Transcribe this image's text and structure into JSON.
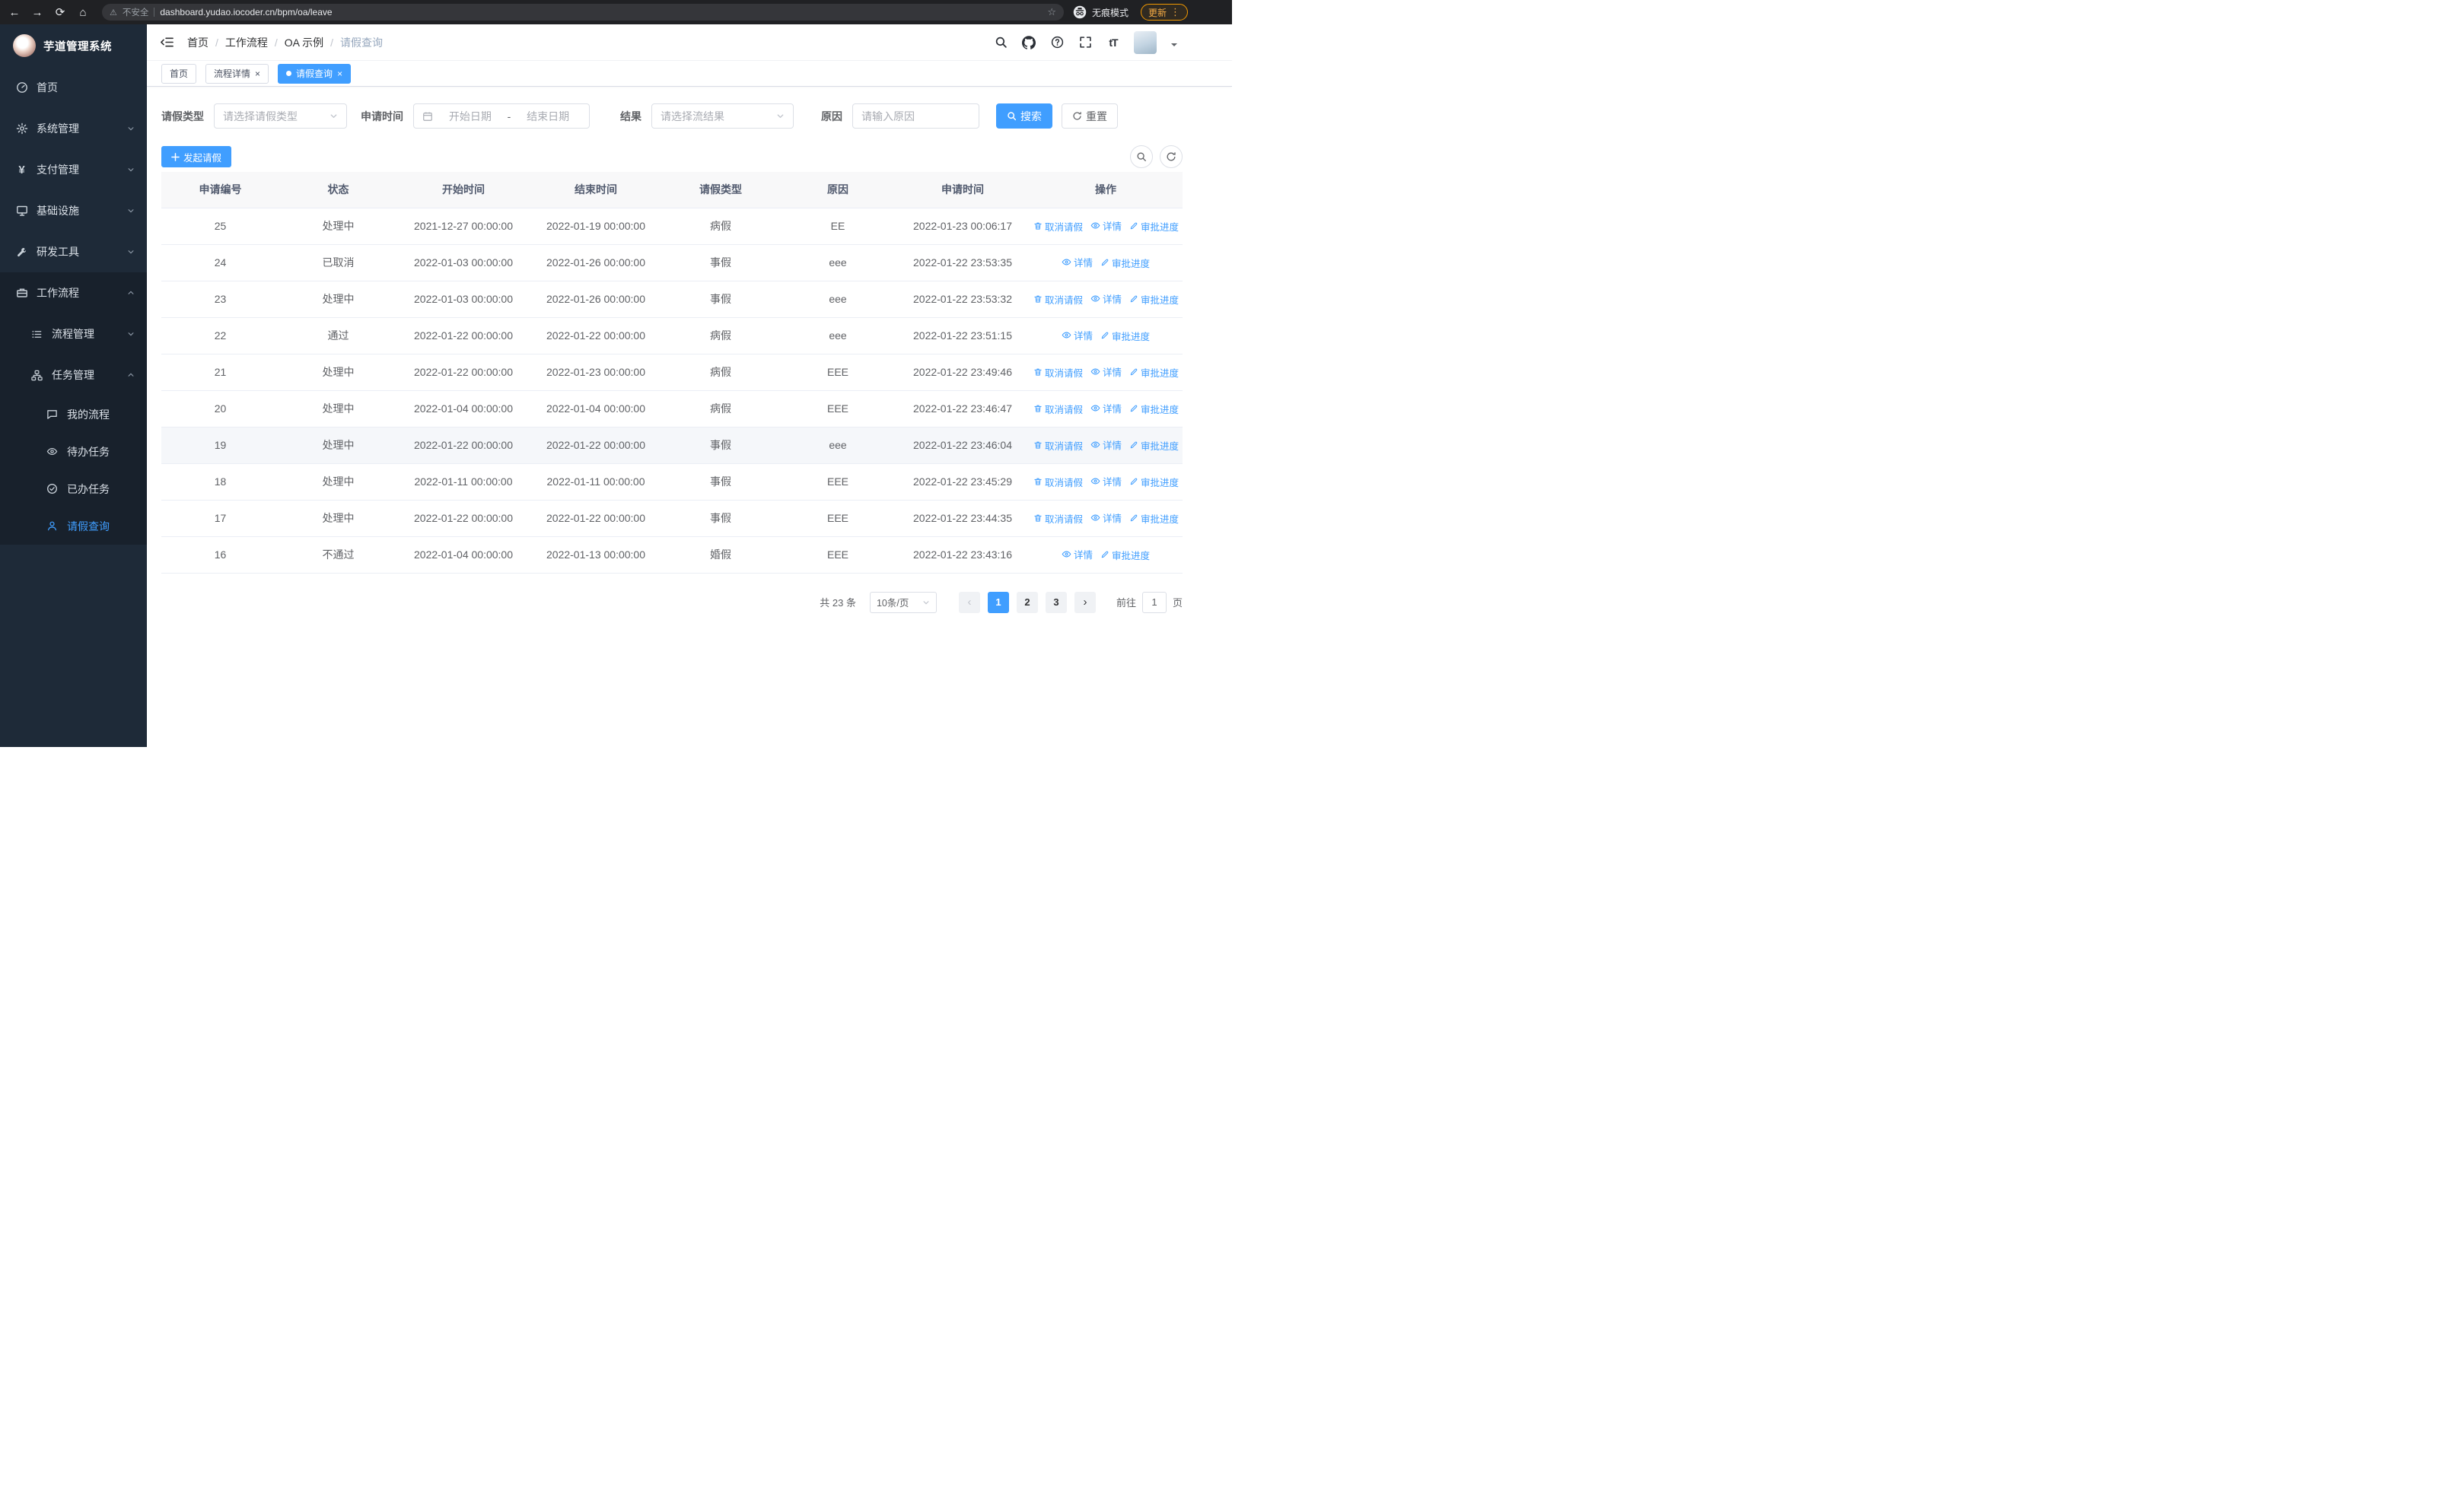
{
  "colors": {
    "accent": "#409eff",
    "sidebar_bg": "#1e2a38",
    "sidebar_submenu_bg": "#18212c"
  },
  "browser": {
    "security_label": "不安全",
    "url": "dashboard.yudao.iocoder.cn/bpm/oa/leave",
    "incognito_label": "无痕模式",
    "update_label": "更新"
  },
  "sidebar": {
    "app_title": "芋道管理系统",
    "items": [
      {
        "label": "首页",
        "icon": "dashboard-icon"
      },
      {
        "label": "系统管理",
        "icon": "gear-icon"
      },
      {
        "label": "支付管理",
        "icon": "yen-icon"
      },
      {
        "label": "基础设施",
        "icon": "monitor-icon"
      },
      {
        "label": "研发工具",
        "icon": "wrench-icon"
      },
      {
        "label": "工作流程",
        "icon": "briefcase-icon",
        "expanded": true
      },
      {
        "label": "流程管理",
        "icon": "list-icon"
      },
      {
        "label": "任务管理",
        "icon": "org-icon",
        "expanded": true
      },
      {
        "label": "我的流程",
        "icon": "chat-icon"
      },
      {
        "label": "待办任务",
        "icon": "eye-icon"
      },
      {
        "label": "已办任务",
        "icon": "check-circle-icon"
      },
      {
        "label": "请假查询",
        "icon": "user-icon",
        "active": true
      }
    ]
  },
  "header": {
    "breadcrumb": [
      "首页",
      "工作流程",
      "OA 示例",
      "请假查询"
    ],
    "breadcrumb_separator": "/",
    "action_icons": [
      "search-icon",
      "github-icon",
      "help-icon",
      "fullscreen-icon",
      "font-size-icon"
    ],
    "font_size_glyph": "tT"
  },
  "tabs": [
    {
      "label": "首页",
      "closable": false,
      "active": false
    },
    {
      "label": "流程详情",
      "closable": true,
      "active": false
    },
    {
      "label": "请假查询",
      "closable": true,
      "active": true
    }
  ],
  "filters": {
    "leave_type_label": "请假类型",
    "leave_type_placeholder": "请选择请假类型",
    "apply_time_label": "申请时间",
    "start_date_placeholder": "开始日期",
    "range_separator": "-",
    "end_date_placeholder": "结束日期",
    "result_label": "结果",
    "result_placeholder": "请选择流结果",
    "reason_label": "原因",
    "reason_placeholder": "请输入原因",
    "search_button": "搜索",
    "reset_button": "重置"
  },
  "toolbar": {
    "create_button": "发起请假"
  },
  "table": {
    "headers": [
      "申请编号",
      "状态",
      "开始时间",
      "结束时间",
      "请假类型",
      "原因",
      "申请时间",
      "操作"
    ],
    "action_defs": {
      "cancel": {
        "label": "取消请假",
        "icon": "delete-icon"
      },
      "detail": {
        "label": "详情",
        "icon": "eye-icon"
      },
      "progress": {
        "label": "审批进度",
        "icon": "edit-icon"
      }
    },
    "rows": [
      {
        "id": "25",
        "status": "处理中",
        "startTime": "2021-12-27 00:00:00",
        "endTime": "2022-01-19 00:00:00",
        "leaveType": "病假",
        "reason": "EE",
        "applyTime": "2022-01-23 00:06:17",
        "actions": [
          "cancel",
          "detail",
          "progress"
        ],
        "hovered": false
      },
      {
        "id": "24",
        "status": "已取消",
        "startTime": "2022-01-03 00:00:00",
        "endTime": "2022-01-26 00:00:00",
        "leaveType": "事假",
        "reason": "eee",
        "applyTime": "2022-01-22 23:53:35",
        "actions": [
          "detail",
          "progress"
        ],
        "hovered": false
      },
      {
        "id": "23",
        "status": "处理中",
        "startTime": "2022-01-03 00:00:00",
        "endTime": "2022-01-26 00:00:00",
        "leaveType": "事假",
        "reason": "eee",
        "applyTime": "2022-01-22 23:53:32",
        "actions": [
          "cancel",
          "detail",
          "progress"
        ],
        "hovered": false
      },
      {
        "id": "22",
        "status": "通过",
        "startTime": "2022-01-22 00:00:00",
        "endTime": "2022-01-22 00:00:00",
        "leaveType": "病假",
        "reason": "eee",
        "applyTime": "2022-01-22 23:51:15",
        "actions": [
          "detail",
          "progress"
        ],
        "hovered": false
      },
      {
        "id": "21",
        "status": "处理中",
        "startTime": "2022-01-22 00:00:00",
        "endTime": "2022-01-23 00:00:00",
        "leaveType": "病假",
        "reason": "EEE",
        "applyTime": "2022-01-22 23:49:46",
        "actions": [
          "cancel",
          "detail",
          "progress"
        ],
        "hovered": false
      },
      {
        "id": "20",
        "status": "处理中",
        "startTime": "2022-01-04 00:00:00",
        "endTime": "2022-01-04 00:00:00",
        "leaveType": "病假",
        "reason": "EEE",
        "applyTime": "2022-01-22 23:46:47",
        "actions": [
          "cancel",
          "detail",
          "progress"
        ],
        "hovered": false
      },
      {
        "id": "19",
        "status": "处理中",
        "startTime": "2022-01-22 00:00:00",
        "endTime": "2022-01-22 00:00:00",
        "leaveType": "事假",
        "reason": "eee",
        "applyTime": "2022-01-22 23:46:04",
        "actions": [
          "cancel",
          "detail",
          "progress"
        ],
        "hovered": true
      },
      {
        "id": "18",
        "status": "处理中",
        "startTime": "2022-01-11 00:00:00",
        "endTime": "2022-01-11 00:00:00",
        "leaveType": "事假",
        "reason": "EEE",
        "applyTime": "2022-01-22 23:45:29",
        "actions": [
          "cancel",
          "detail",
          "progress"
        ],
        "hovered": false
      },
      {
        "id": "17",
        "status": "处理中",
        "startTime": "2022-01-22 00:00:00",
        "endTime": "2022-01-22 00:00:00",
        "leaveType": "事假",
        "reason": "EEE",
        "applyTime": "2022-01-22 23:44:35",
        "actions": [
          "cancel",
          "detail",
          "progress"
        ],
        "hovered": false
      },
      {
        "id": "16",
        "status": "不通过",
        "startTime": "2022-01-04 00:00:00",
        "endTime": "2022-01-13 00:00:00",
        "leaveType": "婚假",
        "reason": "EEE",
        "applyTime": "2022-01-22 23:43:16",
        "actions": [
          "detail",
          "progress"
        ],
        "hovered": false
      }
    ]
  },
  "pagination": {
    "total_text": "共 23 条",
    "page_size": "10条/页",
    "pages": [
      "1",
      "2",
      "3"
    ],
    "active_page": "1",
    "goto_label": "前往",
    "goto_value": "1",
    "goto_suffix": "页"
  }
}
